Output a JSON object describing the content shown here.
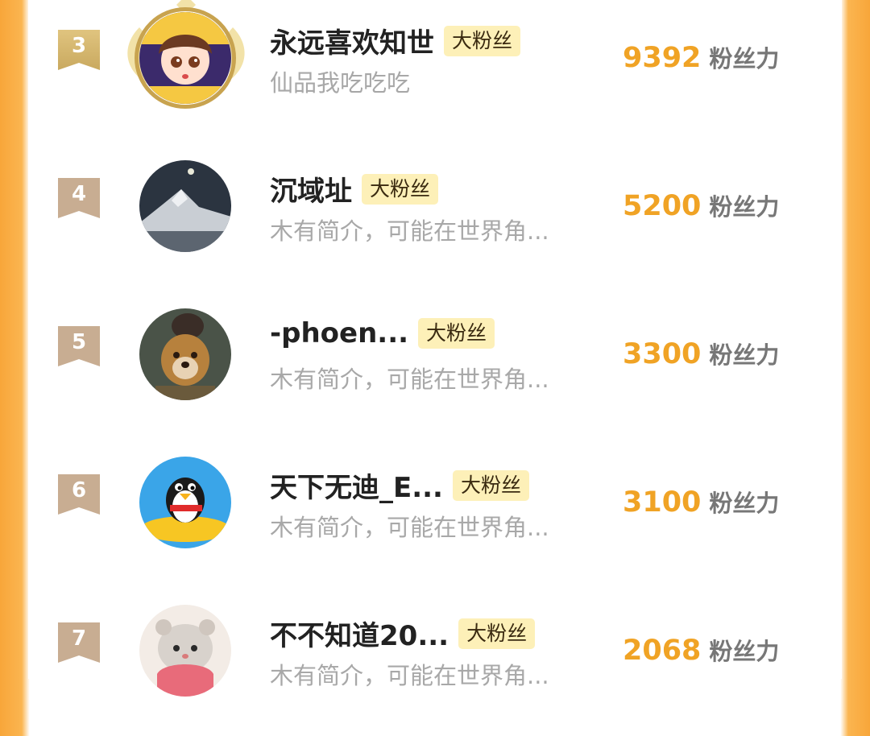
{
  "badge_label": "大粉丝",
  "unit_label": "粉丝力",
  "rows": [
    {
      "rank": "3",
      "name": "永远喜欢知世",
      "bio": "仙品我吃吃吃",
      "score": "9392"
    },
    {
      "rank": "4",
      "name": "沉域址",
      "bio": "木有简介，可能在世界角...",
      "score": "5200"
    },
    {
      "rank": "5",
      "name": "-phoen...",
      "bio": "木有简介，可能在世界角...",
      "score": "3300"
    },
    {
      "rank": "6",
      "name": "天下无迪_E...",
      "bio": "木有简介，可能在世界角...",
      "score": "3100"
    },
    {
      "rank": "7",
      "name": "不不知道20...",
      "bio": "木有简介，可能在世界角...",
      "score": "2068"
    }
  ],
  "colors": {
    "accent_orange": "#f0a325",
    "badge_bg": "#fdf0b8",
    "rank_ribbon": "#c8ad92",
    "rank_ribbon_top": "#c9a95f",
    "side_frame": "#f8a63a"
  }
}
